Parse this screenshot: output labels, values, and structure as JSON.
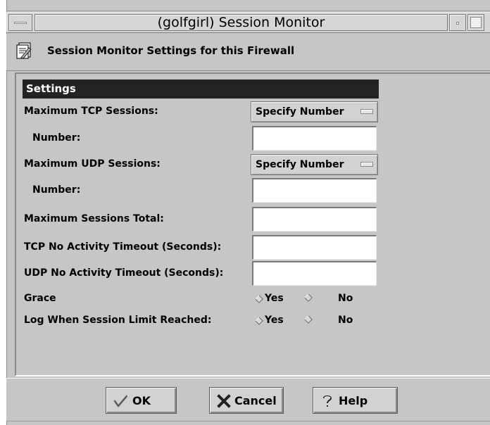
{
  "window": {
    "title": "(golfgirl) Session Monitor"
  },
  "header": {
    "text": "Session Monitor Settings for this Firewall",
    "icon": "settings-document-icon"
  },
  "settings": {
    "section_title": "Settings",
    "rows": {
      "max_tcp": {
        "label": "Maximum TCP Sessions:",
        "option_value": "Specify Number"
      },
      "tcp_number": {
        "label": "Number:",
        "value": ""
      },
      "max_udp": {
        "label": "Maximum UDP Sessions:",
        "option_value": "Specify Number"
      },
      "udp_number": {
        "label": "Number:",
        "value": ""
      },
      "max_total": {
        "label": "Maximum Sessions Total:",
        "value": ""
      },
      "tcp_timeout": {
        "label": "TCP No Activity Timeout (Seconds):",
        "value": ""
      },
      "udp_timeout": {
        "label": "UDP No Activity Timeout (Seconds):",
        "value": ""
      },
      "grace": {
        "label": "Grace",
        "yes_label": "Yes",
        "no_label": "No"
      },
      "log_limit": {
        "label": "Log When Session Limit Reached:",
        "yes_label": "Yes",
        "no_label": "No"
      }
    }
  },
  "buttons": {
    "ok": {
      "label": "OK",
      "icon": "checkmark-icon"
    },
    "cancel": {
      "label": "Cancel",
      "icon": "x-icon"
    },
    "help": {
      "label": "Help",
      "icon": "question-icon"
    }
  },
  "colors": {
    "window_bg": "#c6c6c6",
    "section_header_bg": "#232323",
    "section_header_text": "#ffffff",
    "field_bg": "#ffffff"
  }
}
